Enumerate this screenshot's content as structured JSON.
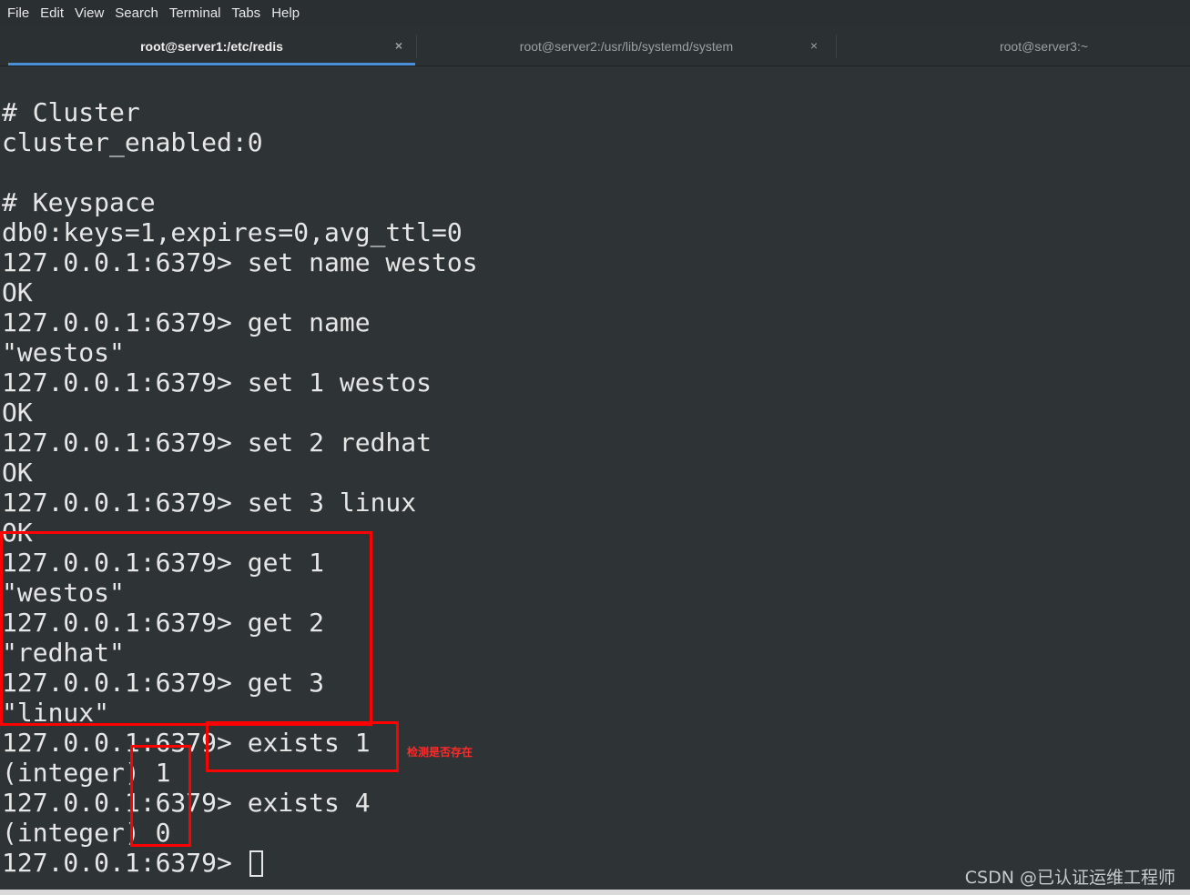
{
  "menu": [
    "File",
    "Edit",
    "View",
    "Search",
    "Terminal",
    "Tabs",
    "Help"
  ],
  "tabs": [
    {
      "title": "root@server1:/etc/redis",
      "active": true,
      "close": "×"
    },
    {
      "title": "root@server2:/usr/lib/systemd/system",
      "active": false,
      "close": "×"
    },
    {
      "title": "root@server3:~",
      "active": false
    }
  ],
  "terminal": {
    "lines": [
      "",
      "# Cluster",
      "cluster_enabled:0",
      "",
      "# Keyspace",
      "db0:keys=1,expires=0,avg_ttl=0",
      "127.0.0.1:6379> set name westos",
      "OK",
      "127.0.0.1:6379> get name",
      "\"westos\"",
      "127.0.0.1:6379> set 1 westos",
      "OK",
      "127.0.0.1:6379> set 2 redhat",
      "OK",
      "127.0.0.1:6379> set 3 linux",
      "OK",
      "127.0.0.1:6379> get 1",
      "\"westos\"",
      "127.0.0.1:6379> get 2",
      "\"redhat\"",
      "127.0.0.1:6379> get 3",
      "\"linux\"",
      "127.0.0.1:6379> exists 1",
      "(integer) 1",
      "127.0.0.1:6379> exists 4",
      "(integer) 0",
      "127.0.0.1:6379> "
    ]
  },
  "annotation": {
    "label": "检测是否存在",
    "color": "#ff0000"
  },
  "watermark": "CSDN @已认证运维工程师",
  "colors": {
    "background": "#2e3436",
    "text": "#e6e6e6",
    "tab_accent": "#4a90d9"
  }
}
